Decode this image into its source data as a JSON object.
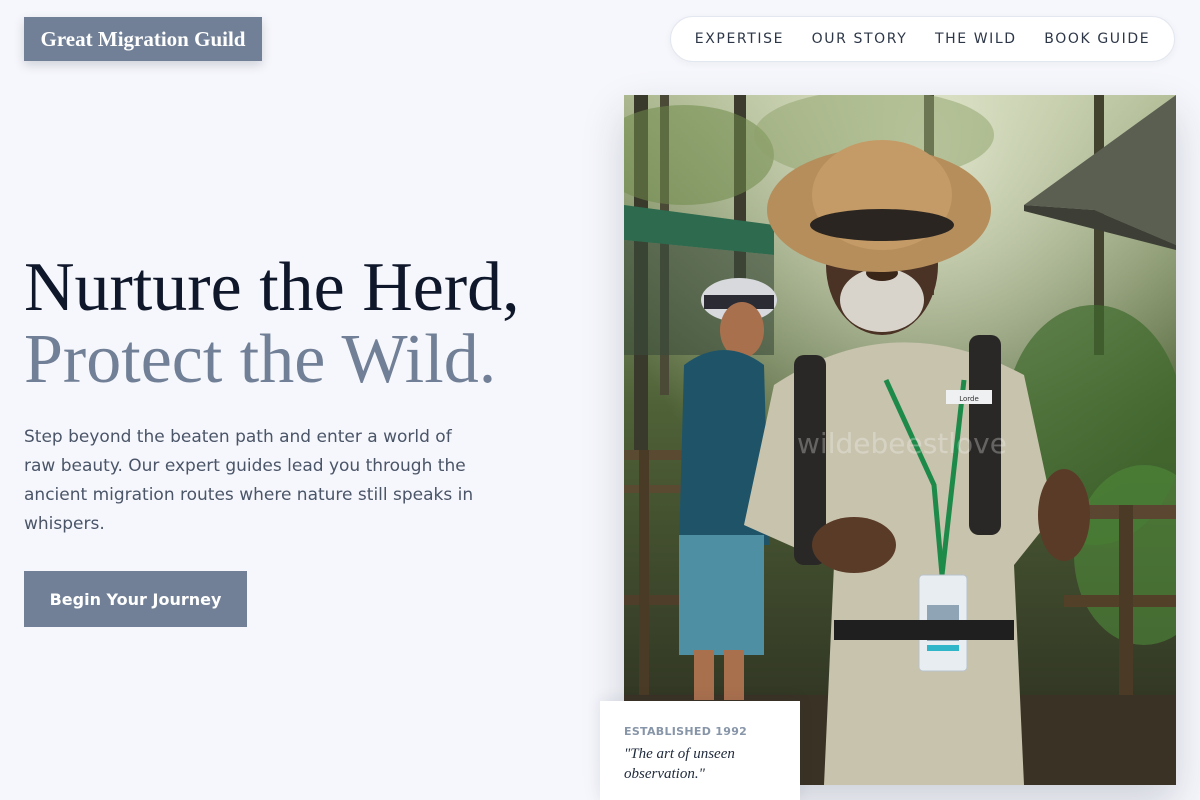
{
  "brand": {
    "name": "Great Migration Guild"
  },
  "nav": {
    "items": [
      {
        "label": "EXPERTISE"
      },
      {
        "label": "OUR STORY"
      },
      {
        "label": "THE WILD"
      },
      {
        "label": "BOOK GUIDE"
      }
    ]
  },
  "hero": {
    "headline_line1": "Nurture the Herd,",
    "headline_line2": "Protect the Wild.",
    "description": "Step beyond the beaten path and enter a world of raw beauty. Our expert guides lead you through the ancient migration routes where nature still speaks in whispers.",
    "cta_label": "Begin Your Journey"
  },
  "photo": {
    "watermark": "wildebeestlove",
    "badge_name": "Lorde"
  },
  "card": {
    "established": "ESTABLISHED 1992",
    "quote": "\"The art of unseen observation.\""
  },
  "colors": {
    "background": "#f6f7fc",
    "accent": "#718096",
    "heading": "#0f172a",
    "body_text": "#4a5568"
  }
}
